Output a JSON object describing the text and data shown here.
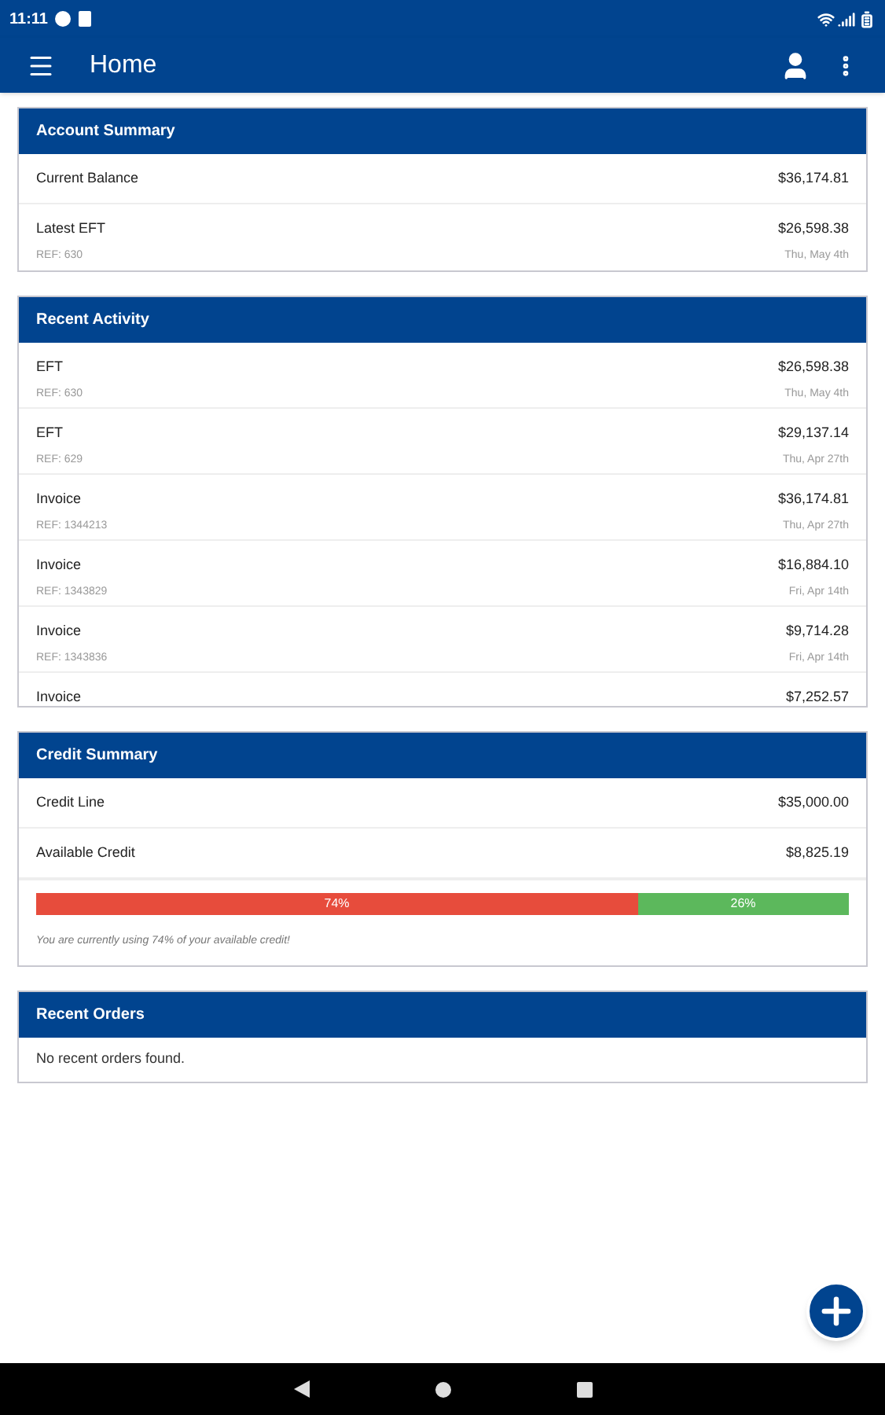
{
  "status_bar": {
    "time": "11:11"
  },
  "app_bar": {
    "title": "Home"
  },
  "account_summary": {
    "title": "Account Summary",
    "rows": [
      {
        "label": "Current Balance",
        "amount": "$36,174.81"
      },
      {
        "label": "Latest EFT",
        "ref": "REF: 630",
        "amount": "$26,598.38",
        "date": "Thu, May 4th"
      }
    ]
  },
  "recent_activity": {
    "title": "Recent Activity",
    "rows": [
      {
        "label": "EFT",
        "ref": "REF: 630",
        "amount": "$26,598.38",
        "date": "Thu, May 4th"
      },
      {
        "label": "EFT",
        "ref": "REF: 629",
        "amount": "$29,137.14",
        "date": "Thu, Apr 27th"
      },
      {
        "label": "Invoice",
        "ref": "REF: 1344213",
        "amount": "$36,174.81",
        "date": "Thu, Apr 27th"
      },
      {
        "label": "Invoice",
        "ref": "REF: 1343829",
        "amount": "$16,884.10",
        "date": "Fri, Apr 14th"
      },
      {
        "label": "Invoice",
        "ref": "REF: 1343836",
        "amount": "$9,714.28",
        "date": "Fri, Apr 14th"
      },
      {
        "label": "Invoice",
        "amount": "$7,252.57"
      }
    ]
  },
  "credit_summary": {
    "title": "Credit Summary",
    "rows": [
      {
        "label": "Credit Line",
        "amount": "$35,000.00"
      },
      {
        "label": "Available Credit",
        "amount": "$8,825.19"
      }
    ],
    "usage": {
      "level": 0.74,
      "used_label": "74%",
      "free_label": "26%"
    },
    "note": "You are currently using 74% of your available credit!"
  },
  "recent_orders": {
    "title": "Recent Orders",
    "empty_text": "No recent orders found."
  }
}
